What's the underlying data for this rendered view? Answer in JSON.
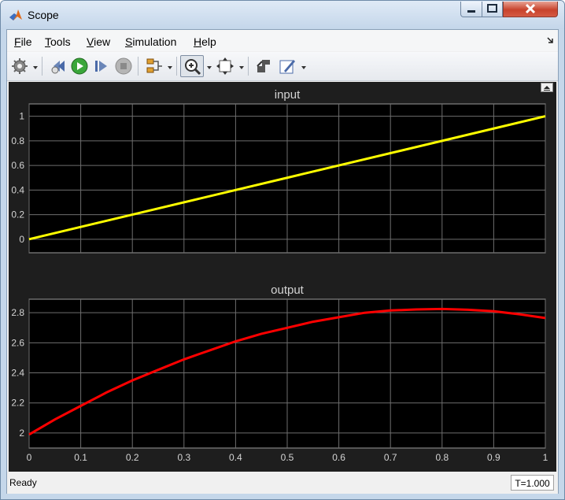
{
  "window": {
    "title": "Scope"
  },
  "menu": [
    {
      "label": "File",
      "mnemonic": "F",
      "rest": "ile"
    },
    {
      "label": "Tools",
      "mnemonic": "T",
      "rest": "ools"
    },
    {
      "label": "View",
      "mnemonic": "V",
      "rest": "iew"
    },
    {
      "label": "Simulation",
      "mnemonic": "S",
      "rest": "imulation"
    },
    {
      "label": "Help",
      "mnemonic": "H",
      "rest": "elp"
    }
  ],
  "toolbar": {
    "icons": [
      "gear-icon",
      "step-back-icon",
      "run-icon",
      "step-forward-icon",
      "stop-icon",
      "signal-selector-icon",
      "zoom-in-icon",
      "autoscale-icon",
      "highlight-block-icon",
      "style-icon"
    ]
  },
  "status": {
    "text": "Ready",
    "time": "T=1.000"
  },
  "colors": {
    "input_line": "#ffff00",
    "output_line": "#ff0000",
    "plot_bg": "#000000",
    "scope_bg": "#1e1e1e",
    "grid": "#6e6e6e",
    "tick_text": "#d4d4d4"
  },
  "chart_data": [
    {
      "type": "line",
      "title": "input",
      "xlim": [
        0,
        1
      ],
      "ylim": [
        -0.11,
        1.1
      ],
      "x_ticks": [
        "0",
        "0.1",
        "0.2",
        "0.3",
        "0.4",
        "0.5",
        "0.6",
        "0.7",
        "0.8",
        "0.9",
        "1"
      ],
      "y_ticks": [
        "0",
        "0.2",
        "0.4",
        "0.6",
        "0.8",
        "1"
      ],
      "show_x_tick_labels": false,
      "grid": true,
      "series": [
        {
          "x": [
            0,
            1
          ],
          "y": [
            0,
            1
          ]
        }
      ]
    },
    {
      "type": "line",
      "title": "output",
      "xlim": [
        0,
        1
      ],
      "ylim": [
        1.9,
        2.89
      ],
      "x_ticks": [
        "0",
        "0.1",
        "0.2",
        "0.3",
        "0.4",
        "0.5",
        "0.6",
        "0.7",
        "0.8",
        "0.9",
        "1"
      ],
      "y_ticks": [
        "2",
        "2.2",
        "2.4",
        "2.6",
        "2.8"
      ],
      "show_x_tick_labels": true,
      "grid": true,
      "series": [
        {
          "x": [
            0,
            0.05,
            0.1,
            0.15,
            0.2,
            0.25,
            0.3,
            0.35,
            0.4,
            0.45,
            0.5,
            0.55,
            0.6,
            0.65,
            0.7,
            0.75,
            0.8,
            0.85,
            0.9,
            0.95,
            1.0
          ],
          "y": [
            1.99,
            2.09,
            2.18,
            2.27,
            2.35,
            2.42,
            2.49,
            2.55,
            2.61,
            2.66,
            2.7,
            2.74,
            2.77,
            2.8,
            2.815,
            2.822,
            2.825,
            2.82,
            2.81,
            2.79,
            2.765
          ]
        }
      ]
    }
  ]
}
